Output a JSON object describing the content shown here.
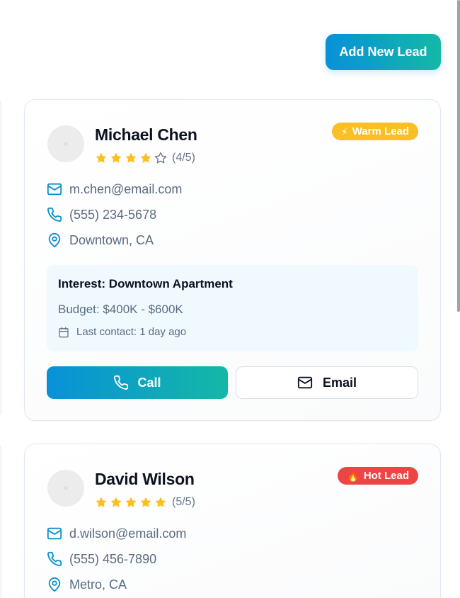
{
  "header": {
    "add_lead_label": "Add New Lead"
  },
  "colors": {
    "accent_start": "#0891d8",
    "accent_end": "#14b8a6",
    "warm_badge": "#fbbf24",
    "hot_badge": "#ef4444",
    "star": "#fbbf24",
    "icon": "#0e8fc9"
  },
  "leads": [
    {
      "name": "Michael Chen",
      "rating": 4,
      "rating_max": 5,
      "rating_text": "(4/5)",
      "badge": {
        "label": "Warm Lead",
        "icon": "lightning-icon",
        "glyph": "⚡"
      },
      "email": "m.chen@email.com",
      "phone": "(555) 234-5678",
      "location": "Downtown, CA",
      "interest": "Interest: Downtown Apartment",
      "budget": "Budget: $400K - $600K",
      "last_contact": "Last contact: 1 day ago",
      "actions": {
        "call_label": "Call",
        "email_label": "Email"
      }
    },
    {
      "name": "David Wilson",
      "rating": 5,
      "rating_max": 5,
      "rating_text": "(5/5)",
      "badge": {
        "label": "Hot Lead",
        "icon": "fire-icon",
        "glyph": "🔥"
      },
      "email": "d.wilson@email.com",
      "phone": "(555) 456-7890",
      "location": "Metro, CA"
    }
  ]
}
